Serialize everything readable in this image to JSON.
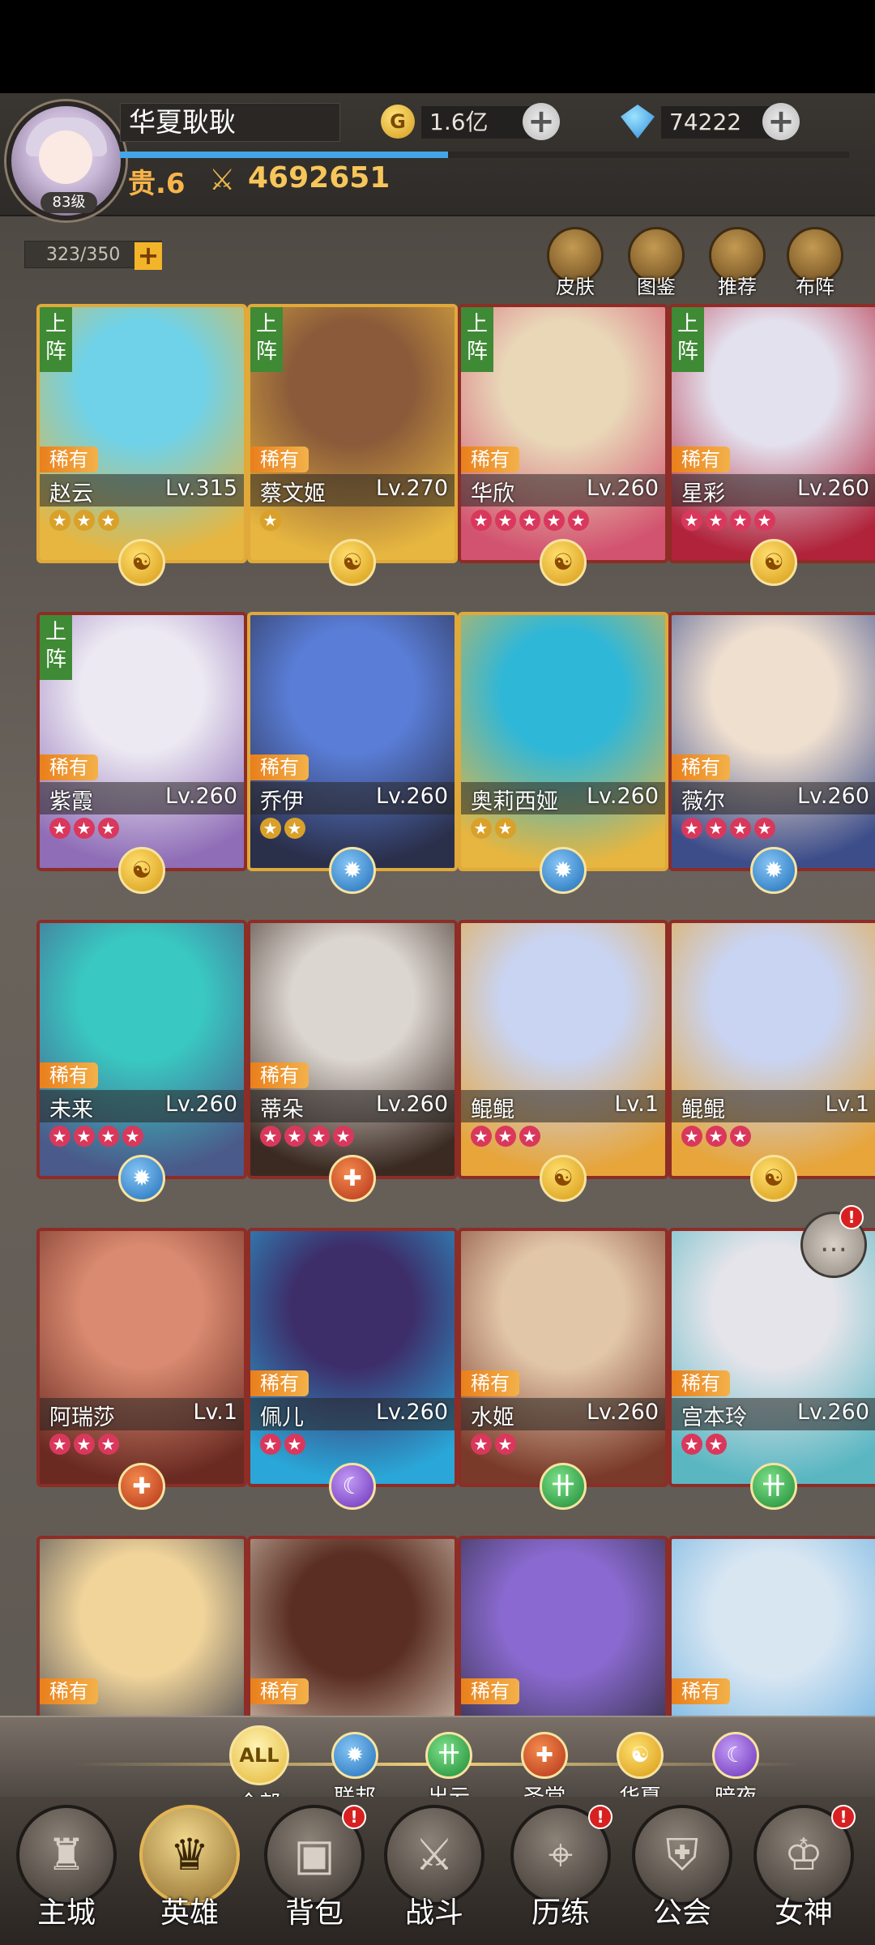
{
  "header": {
    "player_name": "华夏耿耿",
    "avatar_level": "83级",
    "gold_value": "1.6亿",
    "gem_value": "74222",
    "vip_label": "贵.6",
    "power": "4692651",
    "exp_progress": 0.45
  },
  "capacity": "323/350",
  "top_buttons": [
    {
      "label": "皮肤",
      "icon": "skin-icon"
    },
    {
      "label": "图鉴",
      "icon": "codex-icon"
    },
    {
      "label": "推荐",
      "icon": "recommend-icon"
    },
    {
      "label": "布阵",
      "icon": "formation-icon"
    }
  ],
  "deploy_label": "上阵",
  "rarity_label": "稀有",
  "heroes": [
    {
      "name": "赵云",
      "level": "Lv.315",
      "stars": 3,
      "star_color": "gold",
      "faction": "huaxia",
      "deployed": true,
      "rare": true,
      "frame": "gold",
      "color_a": "#6fd2e8",
      "color_b": "#e6b640"
    },
    {
      "name": "蔡文姬",
      "level": "Lv.270",
      "stars": 1,
      "star_color": "gold",
      "faction": "huaxia",
      "deployed": true,
      "rare": true,
      "frame": "gold",
      "color_a": "#8a5a3a",
      "color_b": "#e6b640"
    },
    {
      "name": "华欣",
      "level": "Lv.260",
      "stars": 5,
      "star_color": "red",
      "faction": "huaxia",
      "deployed": true,
      "rare": true,
      "frame": "red",
      "color_a": "#e9d7b8",
      "color_b": "#d2536f"
    },
    {
      "name": "星彩",
      "level": "Lv.260",
      "stars": 4,
      "star_color": "red",
      "faction": "huaxia",
      "deployed": true,
      "rare": true,
      "frame": "red",
      "color_a": "#e4e1ee",
      "color_b": "#b0233a"
    },
    {
      "name": "紫霞",
      "level": "Lv.260",
      "stars": 3,
      "star_color": "red",
      "faction": "huaxia",
      "deployed": true,
      "rare": true,
      "frame": "red",
      "color_a": "#ece9f2",
      "color_b": "#8f6db7"
    },
    {
      "name": "乔伊",
      "level": "Lv.260",
      "stars": 2,
      "star_color": "gold",
      "faction": "lianbang",
      "deployed": false,
      "rare": true,
      "frame": "gold",
      "color_a": "#5a7ed8",
      "color_b": "#2a2f4a"
    },
    {
      "name": "奥莉西娅",
      "level": "Lv.260",
      "stars": 2,
      "star_color": "gold",
      "faction": "lianbang",
      "deployed": false,
      "rare": false,
      "frame": "gold",
      "color_a": "#2fb7d8",
      "color_b": "#e6b640"
    },
    {
      "name": "薇尔",
      "level": "Lv.260",
      "stars": 4,
      "star_color": "red",
      "faction": "lianbang",
      "deployed": false,
      "rare": true,
      "frame": "red",
      "color_a": "#efdfcf",
      "color_b": "#3c4d8a"
    },
    {
      "name": "未来",
      "level": "Lv.260",
      "stars": 4,
      "star_color": "red",
      "faction": "lianbang",
      "deployed": false,
      "rare": true,
      "frame": "red",
      "color_a": "#39c9c2",
      "color_b": "#4a5a8a"
    },
    {
      "name": "蒂朵",
      "level": "Lv.260",
      "stars": 4,
      "star_color": "red",
      "faction": "shengtang",
      "deployed": false,
      "rare": true,
      "frame": "red",
      "color_a": "#dcd6d0",
      "color_b": "#3a2a22"
    },
    {
      "name": "鲲鲲",
      "level": "Lv.1",
      "stars": 3,
      "star_color": "red",
      "faction": "huaxia",
      "deployed": false,
      "rare": false,
      "frame": "red",
      "color_a": "#c9d4f2",
      "color_b": "#e7a53a"
    },
    {
      "name": "鲲鲲",
      "level": "Lv.1",
      "stars": 3,
      "star_color": "red",
      "faction": "huaxia",
      "deployed": false,
      "rare": false,
      "frame": "red",
      "color_a": "#c9d4f2",
      "color_b": "#e7a53a"
    },
    {
      "name": "阿瑞莎",
      "level": "Lv.1",
      "stars": 3,
      "star_color": "red",
      "faction": "shengtang",
      "deployed": false,
      "rare": false,
      "frame": "red",
      "color_a": "#d98a70",
      "color_b": "#6a2a22"
    },
    {
      "name": "佩儿",
      "level": "Lv.260",
      "stars": 2,
      "star_color": "red",
      "faction": "anye",
      "deployed": false,
      "rare": true,
      "frame": "red",
      "color_a": "#3d2e6a",
      "color_b": "#2aa7d8"
    },
    {
      "name": "水姬",
      "level": "Lv.260",
      "stars": 2,
      "star_color": "red",
      "faction": "chuyun",
      "deployed": false,
      "rare": true,
      "frame": "red",
      "color_a": "#e2c6a8",
      "color_b": "#7a3a2a"
    },
    {
      "name": "宫本玲",
      "level": "Lv.260",
      "stars": 2,
      "star_color": "red",
      "faction": "chuyun",
      "deployed": false,
      "rare": true,
      "frame": "red",
      "color_a": "#e4e4ea",
      "color_b": "#5ab7c2"
    },
    {
      "name": "",
      "level": "",
      "stars": 0,
      "star_color": "red",
      "faction": "",
      "deployed": false,
      "rare": true,
      "frame": "red",
      "color_a": "#f0d49a",
      "color_b": "#3a3a4a"
    },
    {
      "name": "",
      "level": "",
      "stars": 0,
      "star_color": "red",
      "faction": "",
      "deployed": false,
      "rare": true,
      "frame": "red",
      "color_a": "#5a2e22",
      "color_b": "#d9c9b8"
    },
    {
      "name": "",
      "level": "",
      "stars": 0,
      "star_color": "red",
      "faction": "",
      "deployed": false,
      "rare": true,
      "frame": "red",
      "color_a": "#8a6ad0",
      "color_b": "#2a2a3a"
    },
    {
      "name": "",
      "level": "",
      "stars": 0,
      "star_color": "red",
      "faction": "",
      "deployed": false,
      "rare": true,
      "frame": "red",
      "color_a": "#d8e6f2",
      "color_b": "#6ab0e0"
    }
  ],
  "filters": [
    {
      "label": "全部",
      "icon": "ALL",
      "faction": "all"
    },
    {
      "label": "联邦",
      "icon": "✹",
      "faction": "lianbang"
    },
    {
      "label": "出云",
      "icon": "卄",
      "faction": "chuyun"
    },
    {
      "label": "圣堂",
      "icon": "✚",
      "faction": "shengtang"
    },
    {
      "label": "华夏",
      "icon": "☯",
      "faction": "huaxia"
    },
    {
      "label": "暗夜",
      "icon": "☾",
      "faction": "anye"
    }
  ],
  "nav": [
    {
      "label": "主城",
      "icon": "castle-icon",
      "glyph": "♜",
      "badge": false,
      "active": false
    },
    {
      "label": "英雄",
      "icon": "hero-icon",
      "glyph": "♛",
      "badge": false,
      "active": true
    },
    {
      "label": "背包",
      "icon": "backpack-icon",
      "glyph": "▣",
      "badge": true,
      "active": false
    },
    {
      "label": "战斗",
      "icon": "swords-icon",
      "glyph": "⚔",
      "badge": false,
      "active": false
    },
    {
      "label": "历练",
      "icon": "map-icon",
      "glyph": "⌖",
      "badge": true,
      "active": false
    },
    {
      "label": "公会",
      "icon": "shield-icon",
      "glyph": "⛨",
      "badge": false,
      "active": false
    },
    {
      "label": "女神",
      "icon": "goddess-icon",
      "glyph": "♔",
      "badge": true,
      "active": false
    }
  ],
  "badge_mark": "!",
  "colors": {
    "accent": "#f2b428",
    "deploy": "#3f8a35",
    "rarity": "#e97f1c"
  }
}
